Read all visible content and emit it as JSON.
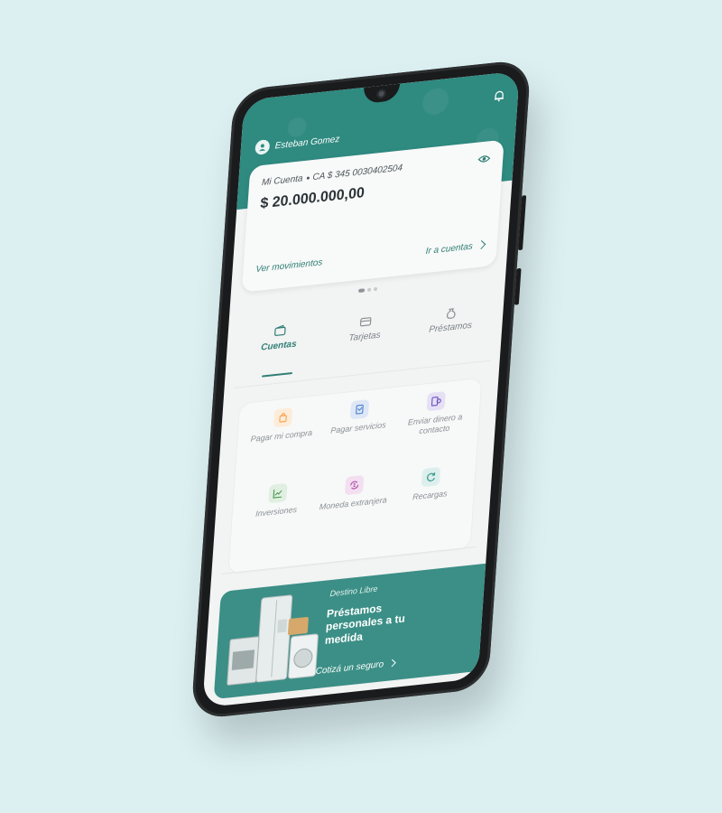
{
  "user": {
    "name": "Esteban Gomez"
  },
  "account": {
    "label": "Mi Cuenta",
    "number": "CA $ 345 0030402504",
    "balance": "$ 20.000.000,00",
    "movements_link": "Ver movimientos",
    "accounts_link": "Ir a cuentas"
  },
  "tabs": [
    {
      "label": "Cuentas",
      "icon": "wallet-icon",
      "active": true
    },
    {
      "label": "Tarjetas",
      "icon": "card-icon"
    },
    {
      "label": "Préstamos",
      "icon": "money-bag-icon"
    }
  ],
  "actions": [
    {
      "label": "Pagar mi compra",
      "icon": "shopping-bag-icon",
      "color": "#f5a04a"
    },
    {
      "label": "Pagar servicios",
      "icon": "receipt-icon",
      "color": "#4a7fd0"
    },
    {
      "label": "Enviar dinero a contacto",
      "icon": "send-money-icon",
      "color": "#6b4fc0"
    },
    {
      "label": "Inversiones",
      "icon": "chart-up-icon",
      "color": "#4a9a4f"
    },
    {
      "label": "Moneda extranjera",
      "icon": "currency-exchange-icon",
      "color": "#b04aa8"
    },
    {
      "label": "Recargas",
      "icon": "refresh-icon",
      "color": "#3a9a8e"
    }
  ],
  "promo": {
    "tag": "Destino Libre",
    "title": "Préstamos personales a tu medida",
    "cta": "Cotizá un seguro"
  },
  "colors": {
    "primary": "#2f8a80",
    "background": "#dcf0f2",
    "accent": "#b6d34a"
  }
}
